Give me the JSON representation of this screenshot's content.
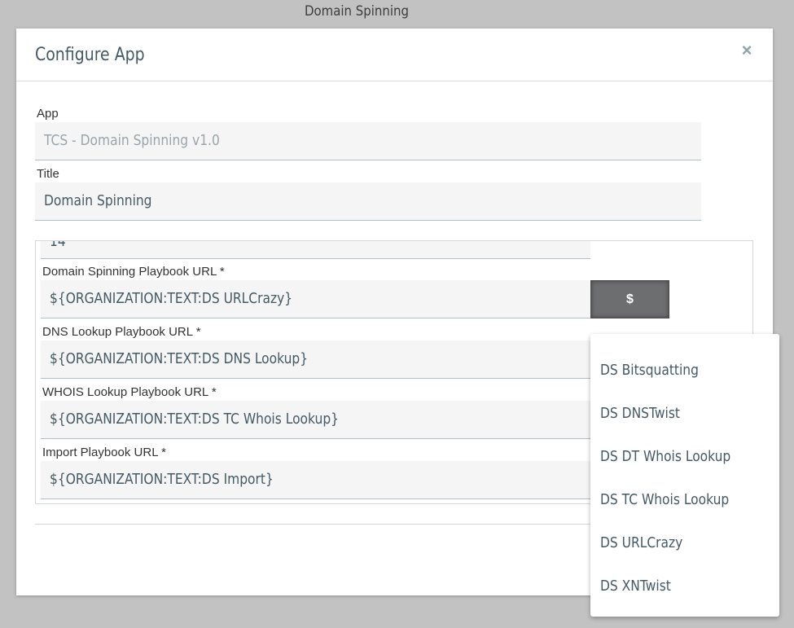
{
  "page": {
    "header": "Domain Spinning"
  },
  "modal": {
    "title": "Configure App",
    "close_glyph": "×",
    "fields": {
      "app": {
        "label": "App",
        "value": "TCS - Domain Spinning v1.0"
      },
      "title": {
        "label": "Title",
        "value": "Domain Spinning"
      }
    },
    "params": {
      "partial_value": "14",
      "domain_spinning": {
        "label": "Domain Spinning Playbook URL *",
        "value": "${ORGANIZATION:TEXT:DS URLCrazy}"
      },
      "dns_lookup": {
        "label": "DNS Lookup Playbook URL *",
        "value": "${ORGANIZATION:TEXT:DS DNS Lookup}"
      },
      "whois_lookup": {
        "label": "WHOIS Lookup Playbook URL *",
        "value": "${ORGANIZATION:TEXT:DS TC Whois Lookup}"
      },
      "import": {
        "label": "Import Playbook URL *",
        "value": "${ORGANIZATION:TEXT:DS Import}"
      }
    },
    "variable_button": {
      "label": "$"
    }
  },
  "dropdown": {
    "items": [
      {
        "label": "DS Bitsquatting"
      },
      {
        "label": "DS DNSTwist"
      },
      {
        "label": "DS DT Whois Lookup"
      },
      {
        "label": "DS TC Whois Lookup"
      },
      {
        "label": "DS URLCrazy"
      },
      {
        "label": "DS XNTwist"
      }
    ]
  },
  "colors": {
    "backdrop": "#c2c2c2",
    "text": "#455a64",
    "field_bg": "#f5f5f5",
    "button_bg": "#6d6e70"
  }
}
